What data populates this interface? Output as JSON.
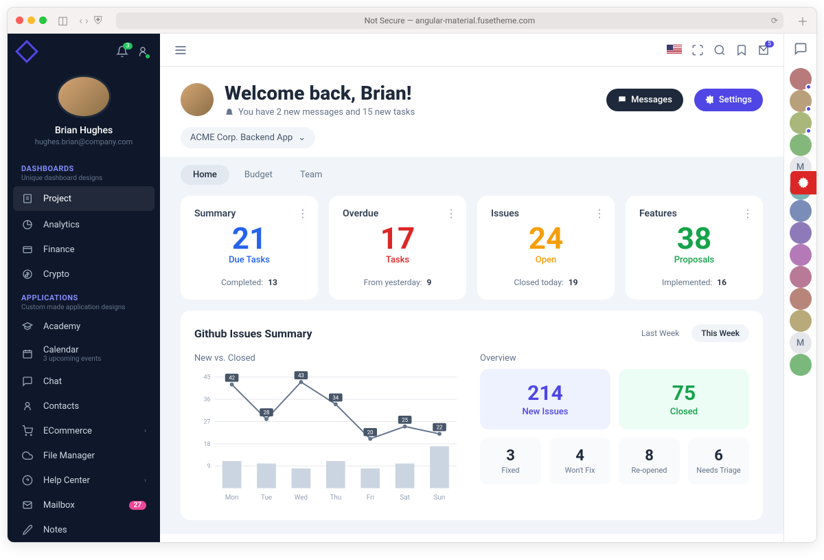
{
  "browser": {
    "url": "Not Secure — angular-material.fusetheme.com"
  },
  "user": {
    "name": "Brian Hughes",
    "email": "hughes.brian@company.com"
  },
  "sidebar": {
    "notif_badge": "3",
    "sections": [
      {
        "title": "DASHBOARDS",
        "sub": "Unique dashboard designs"
      },
      {
        "title": "APPLICATIONS",
        "sub": "Custom made application designs"
      }
    ],
    "dashboards": [
      {
        "label": "Project",
        "active": true
      },
      {
        "label": "Analytics"
      },
      {
        "label": "Finance"
      },
      {
        "label": "Crypto"
      }
    ],
    "apps": [
      {
        "label": "Academy"
      },
      {
        "label": "Calendar",
        "sub": "3 upcoming events"
      },
      {
        "label": "Chat"
      },
      {
        "label": "Contacts"
      },
      {
        "label": "ECommerce",
        "chevron": true
      },
      {
        "label": "File Manager"
      },
      {
        "label": "Help Center",
        "chevron": true
      },
      {
        "label": "Mailbox",
        "badge": "27"
      },
      {
        "label": "Notes"
      }
    ]
  },
  "topbar": {
    "mail_badge": "5"
  },
  "header": {
    "title": "Welcome back, Brian!",
    "sub": "You have 2 new messages and 15 new tasks",
    "messages_btn": "Messages",
    "settings_btn": "Settings"
  },
  "project_selector": "ACME Corp. Backend App",
  "tabs": [
    "Home",
    "Budget",
    "Team"
  ],
  "cards": [
    {
      "title": "Summary",
      "num": "21",
      "label": "Due Tasks",
      "foot_label": "Completed:",
      "foot_val": "13",
      "color": "c-blue"
    },
    {
      "title": "Overdue",
      "num": "17",
      "label": "Tasks",
      "foot_label": "From yesterday:",
      "foot_val": "9",
      "color": "c-red"
    },
    {
      "title": "Issues",
      "num": "24",
      "label": "Open",
      "foot_label": "Closed today:",
      "foot_val": "19",
      "color": "c-amber"
    },
    {
      "title": "Features",
      "num": "38",
      "label": "Proposals",
      "foot_label": "Implemented:",
      "foot_val": "16",
      "color": "c-green"
    }
  ],
  "chart": {
    "title": "Github Issues Summary",
    "left_sub": "New vs. Closed",
    "right_sub": "Overview",
    "toggle": [
      "Last Week",
      "This Week"
    ]
  },
  "chart_data": {
    "type": "combo",
    "categories": [
      "Mon",
      "Tue",
      "Wed",
      "Thu",
      "Fri",
      "Sat",
      "Sun"
    ],
    "series": [
      {
        "name": "New (line)",
        "type": "line",
        "values": [
          42,
          28,
          43,
          34,
          20,
          25,
          22
        ]
      },
      {
        "name": "Closed (bar)",
        "type": "bar",
        "values": [
          11,
          10,
          8,
          11,
          8,
          10,
          17
        ]
      }
    ],
    "ylim": [
      0,
      45
    ],
    "yticks": [
      9,
      18,
      27,
      36,
      45
    ]
  },
  "overview": {
    "big": [
      {
        "num": "214",
        "label": "New Issues",
        "cls": "ov-blue",
        "numcolor": "#4f46e5"
      },
      {
        "num": "75",
        "label": "Closed",
        "cls": "ov-green",
        "numcolor": "#16a34a"
      }
    ],
    "small": [
      {
        "num": "3",
        "label": "Fixed"
      },
      {
        "num": "4",
        "label": "Won't Fix"
      },
      {
        "num": "8",
        "label": "Re-opened"
      },
      {
        "num": "6",
        "label": "Needs Triage"
      }
    ]
  },
  "contacts_letters": [
    "M",
    "M"
  ]
}
